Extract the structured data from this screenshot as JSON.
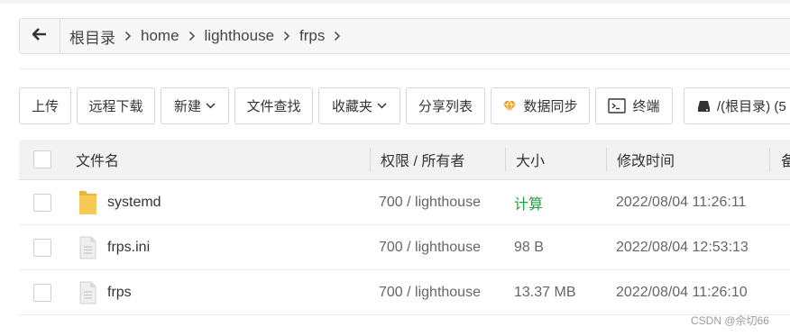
{
  "breadcrumb": {
    "back_icon": "arrow-left-icon",
    "items": [
      "根目录",
      "home",
      "lighthouse",
      "frps"
    ]
  },
  "toolbar": {
    "upload": "上传",
    "remote_download": "远程下载",
    "new": "新建",
    "find_file": "文件查找",
    "favorites": "收藏夹",
    "share_list": "分享列表",
    "sync": "数据同步",
    "terminal": "终端",
    "disk": "/(根目录) (5"
  },
  "table": {
    "headers": {
      "name": "文件名",
      "perm": "权限 / 所有者",
      "size": "大小",
      "mtime": "修改时间",
      "extra": "备"
    },
    "rows": [
      {
        "icon": "folder-icon",
        "name": "systemd",
        "perm": "700 / lighthouse",
        "size": "计算",
        "mtime": "2022/08/04 11:26:11"
      },
      {
        "icon": "file-icon",
        "name": "frps.ini",
        "perm": "700 / lighthouse",
        "size": "98 B",
        "mtime": "2022/08/04 12:53:13"
      },
      {
        "icon": "file-icon",
        "name": "frps",
        "perm": "700 / lighthouse",
        "size": "13.37 MB",
        "mtime": "2022/08/04 11:26:10"
      }
    ]
  },
  "colors": {
    "accent_green": "#21a23c",
    "folder": "#f5c956",
    "sync_orange": "#f0a020"
  },
  "watermark": "CSDN @佘切66"
}
